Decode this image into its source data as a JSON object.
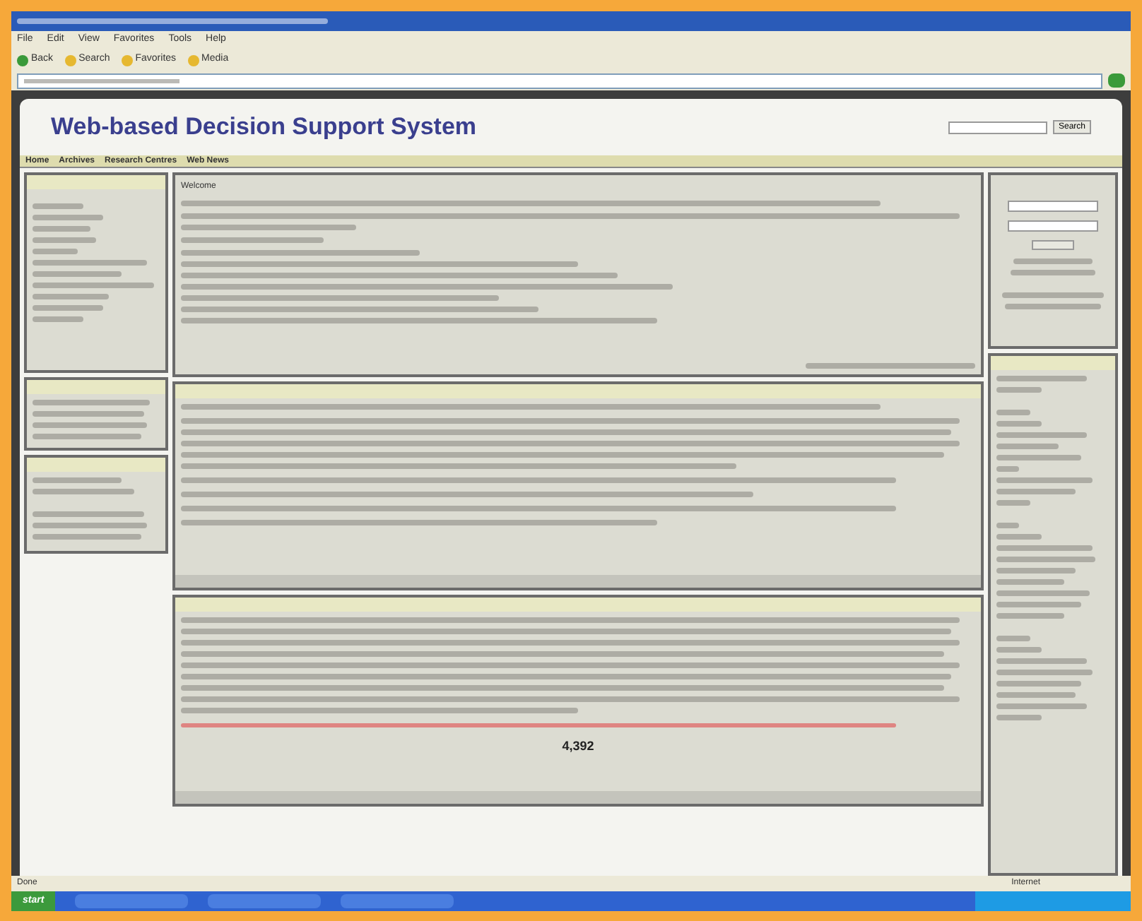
{
  "menu_bar": [
    "File",
    "Edit",
    "View",
    "Favorites",
    "Tools",
    "Help"
  ],
  "toolbar": [
    "Back",
    "Search",
    "Favorites",
    "Media"
  ],
  "site": {
    "title": "Web-based Decision Support System",
    "search_button": "Search"
  },
  "nav": [
    "Home",
    "Archives",
    "Research Centres",
    "Web News"
  ],
  "main_panels": [
    {
      "title": "Welcome"
    },
    {
      "total": "4,392"
    }
  ],
  "status_bar": {
    "left": "Done",
    "right": "Internet"
  },
  "taskbar": {
    "start": "start"
  }
}
